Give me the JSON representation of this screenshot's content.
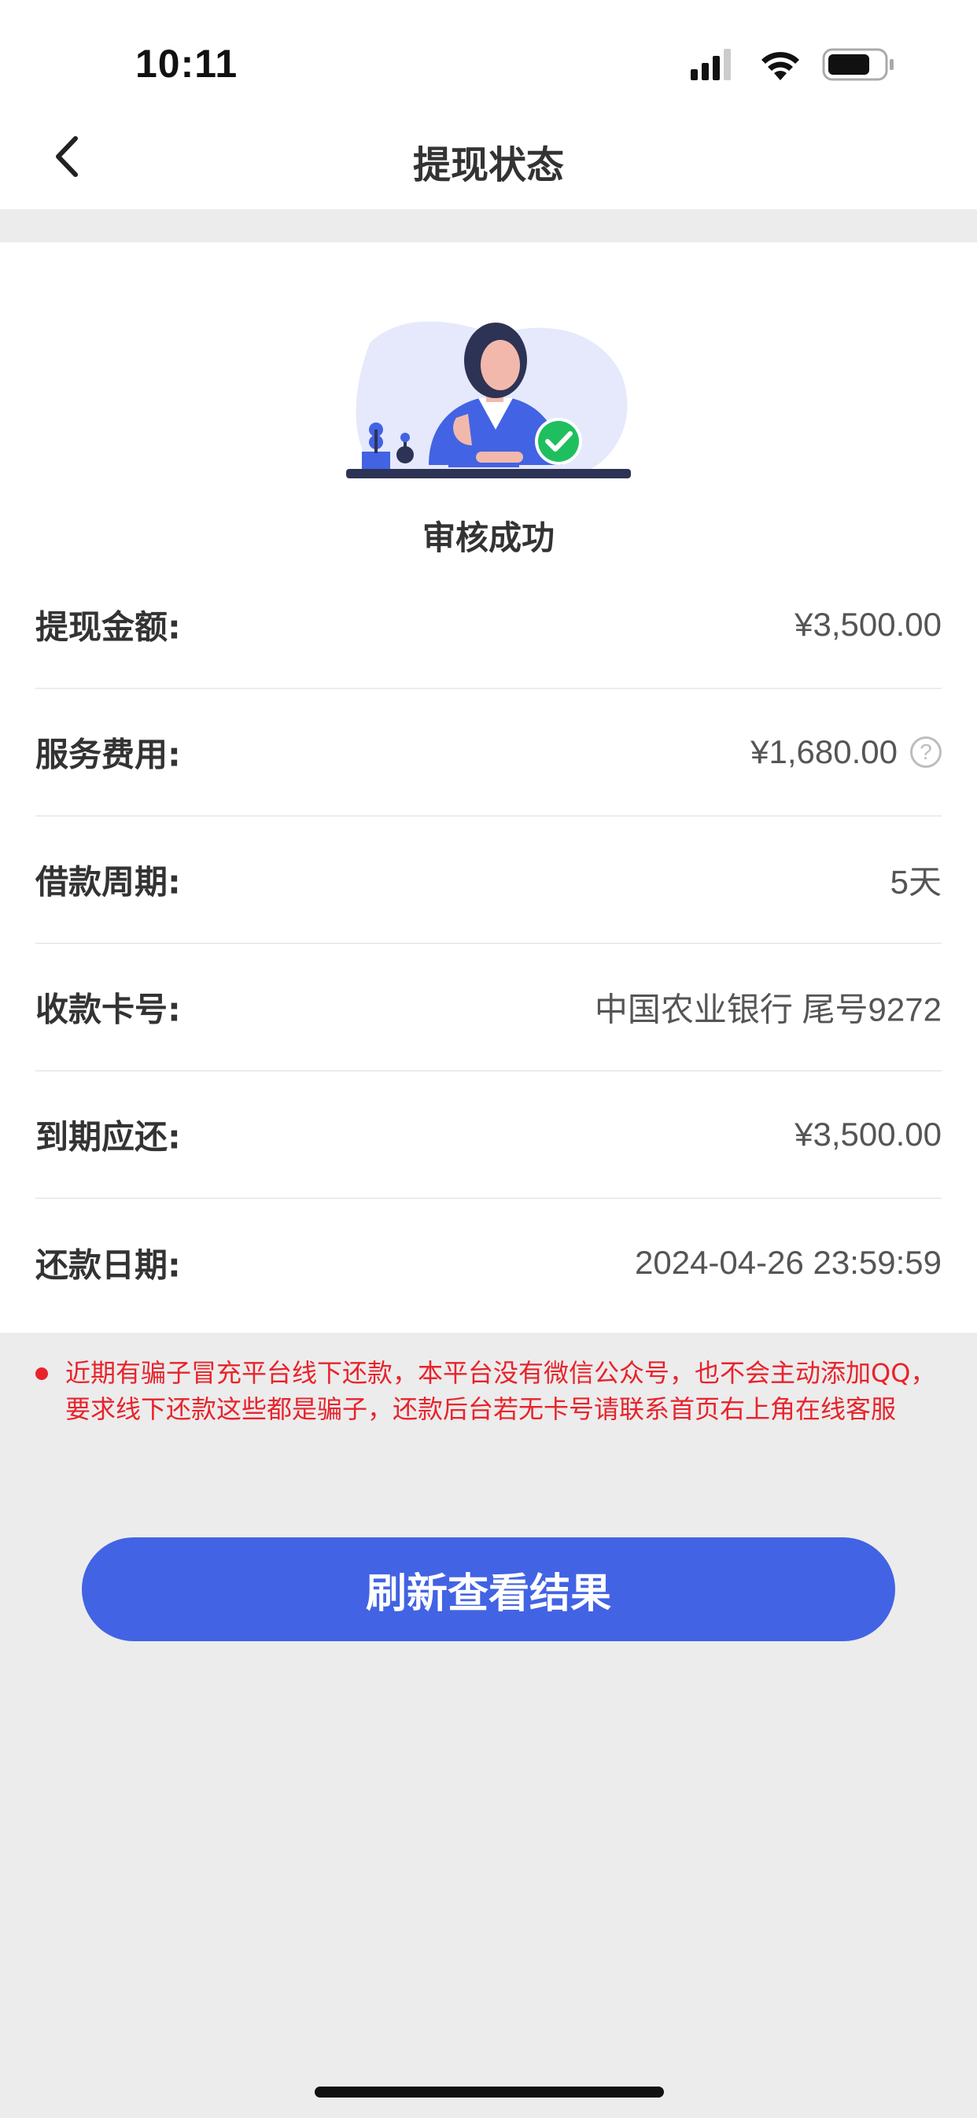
{
  "status_bar": {
    "time": "10:11",
    "icons": [
      "signal-icon",
      "wifi-icon",
      "battery-icon"
    ]
  },
  "nav": {
    "title": "提现状态",
    "back_icon": "chevron-left-icon"
  },
  "review": {
    "status_text": "审核成功",
    "check_color": "#1fbf5f"
  },
  "details": [
    {
      "label": "提现金额:",
      "value": "¥3,500.00"
    },
    {
      "label": "服务费用:",
      "value": "¥1,680.00"
    },
    {
      "label": "借款周期:",
      "value": "5天"
    },
    {
      "label": "收款卡号:",
      "value": "中国农业银行 尾号9272"
    },
    {
      "label": "到期应还:",
      "value": "¥3,500.00"
    },
    {
      "label": "还款日期:",
      "value": "2024-04-26 23:59:59"
    }
  ],
  "help_icon_glyph": "?",
  "warning": {
    "text": "近期有骗子冒充平台线下还款，本平台没有微信公众号，也不会主动添加QQ，要求线下还款这些都是骗子，还款后台若无卡号请联系首页右上角在线客服",
    "color": "#e8232b"
  },
  "refresh_button": {
    "label": "刷新查看结果",
    "color": "#4263e3"
  }
}
